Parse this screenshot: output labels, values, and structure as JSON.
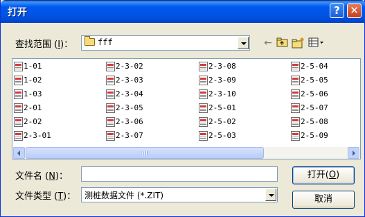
{
  "window": {
    "title": "打开"
  },
  "titlebar": {
    "help_label": "?",
    "close_label": "✕"
  },
  "look_in": {
    "label": "查找范围 (",
    "hotkey": "I",
    "label_end": ")：",
    "value": "fff",
    "icon": "folder-icon"
  },
  "toolbar": {
    "back_icon": "back-arrow-icon",
    "up_icon": "up-folder-icon",
    "new_icon": "new-folder-icon",
    "view_icon": "view-menu-icon"
  },
  "files": {
    "columns": [
      [
        "1-01",
        "1-02",
        "1-03",
        "2-01",
        "2-02",
        "2-3-01"
      ],
      [
        "2-3-02",
        "2-3-03",
        "2-3-04",
        "2-3-05",
        "2-3-06",
        "2-3-07"
      ],
      [
        "2-3-08",
        "2-3-09",
        "2-3-10",
        "2-5-01",
        "2-5-02",
        "2-5-03"
      ],
      [
        "2-5-04",
        "2-5-05",
        "2-5-06",
        "2-5-07",
        "2-5-08",
        "2-5-09"
      ]
    ],
    "icon": "zit-file-icon"
  },
  "filename": {
    "label": "文件名 (",
    "hotkey": "N",
    "label_end": ")：",
    "value": ""
  },
  "filetype": {
    "label": "文件类型 (",
    "hotkey": "T",
    "label_end": ")：",
    "value": "测桩数据文件 (*.ZIT)"
  },
  "buttons": {
    "open_label": "打开(",
    "open_hotkey": "O",
    "open_end": ")",
    "cancel_label": "取消"
  }
}
